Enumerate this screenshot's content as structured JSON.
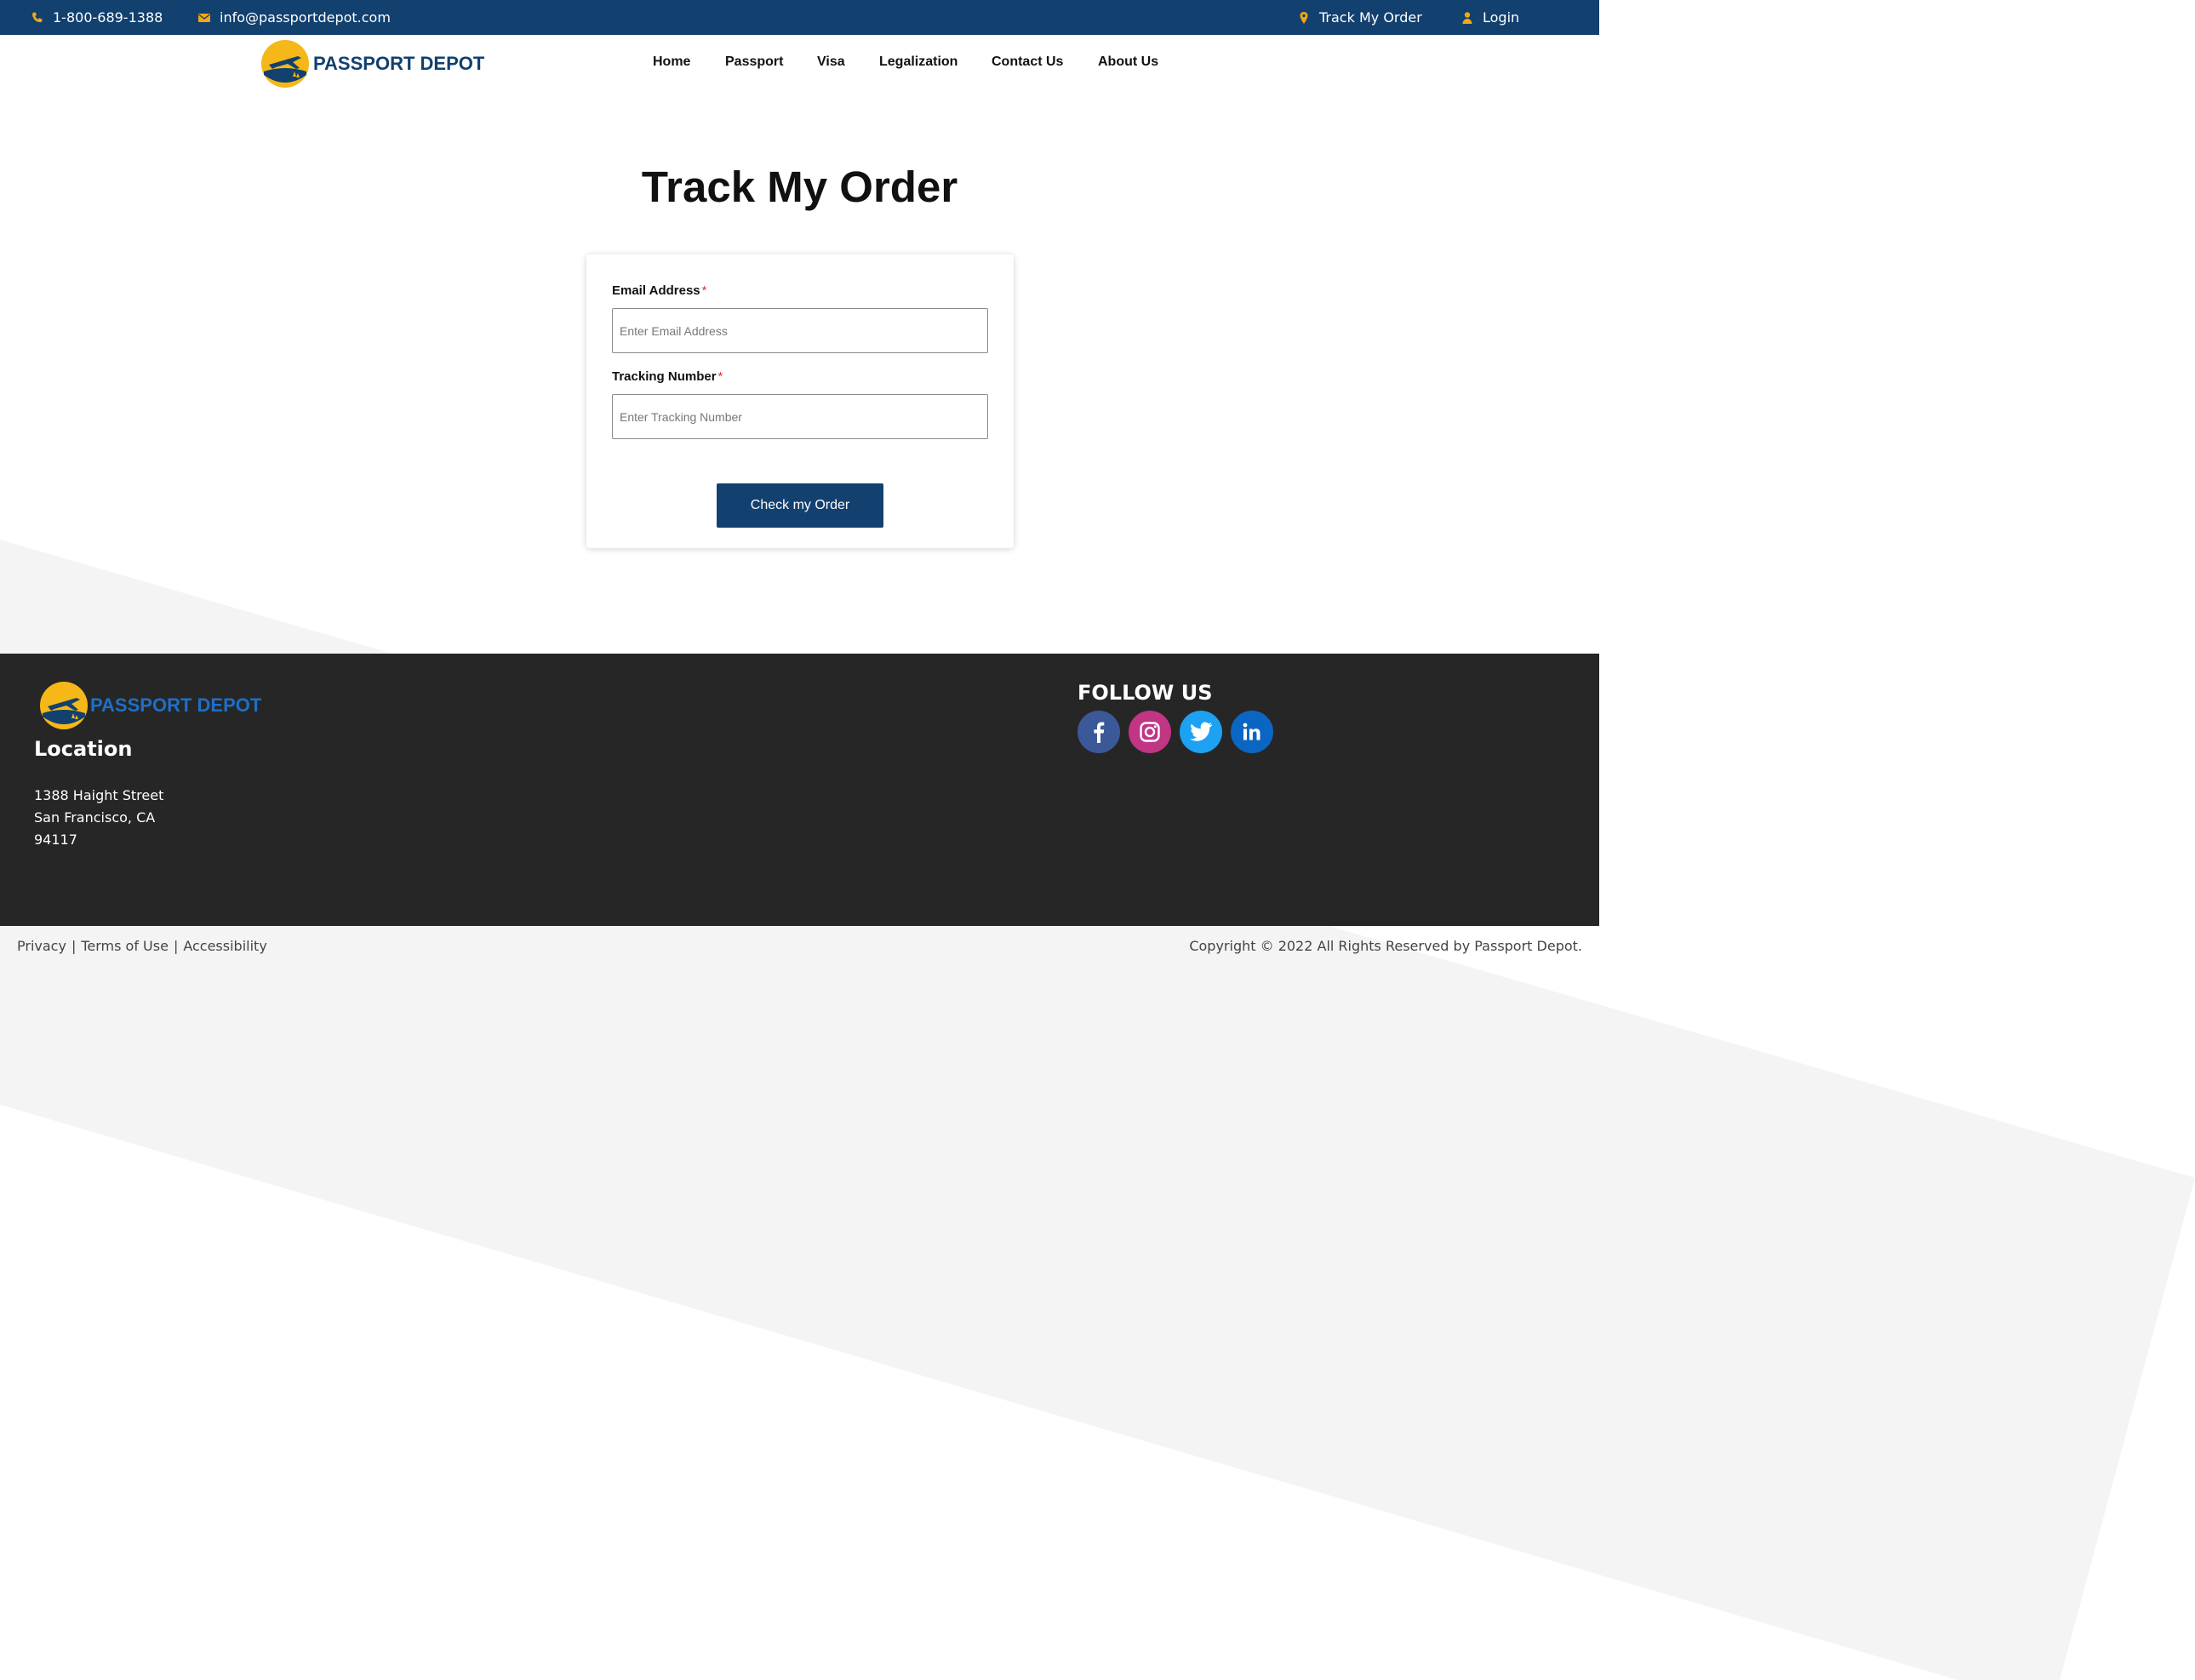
{
  "topbar": {
    "phone": "1-800-689-1388",
    "email": "info@passportdepot.com",
    "track_order": "Track My Order",
    "login": "Login",
    "icons": {
      "phone": "phone-icon",
      "email": "envelope-icon",
      "track": "map-pin-icon",
      "login": "user-icon"
    },
    "icon_color": "#f3a712",
    "background": "#12406f"
  },
  "header": {
    "logo_text": "PASSPORT DEPOT",
    "nav": [
      "Home",
      "Passport",
      "Visa",
      "Legalization",
      "Contact Us",
      "About Us"
    ]
  },
  "main": {
    "title": "Track My Order",
    "form": {
      "email_label": "Email Address",
      "email_placeholder": "Enter Email Address",
      "email_value": "",
      "tracking_label": "Tracking Number",
      "tracking_placeholder": "Enter Tracking Number",
      "tracking_value": "",
      "required_mark": "*",
      "submit_label": "Check my Order"
    }
  },
  "footer": {
    "logo_text": "PASSPORT DEPOT",
    "location_heading": "Location",
    "address": [
      "1388 Haight Street",
      "San Francisco, CA",
      "94117"
    ],
    "follow_heading": "FOLLOW US",
    "socials": [
      {
        "name": "facebook-icon",
        "color": "#3b5998"
      },
      {
        "name": "instagram-icon",
        "color": "#c13584"
      },
      {
        "name": "twitter-icon",
        "color": "#1da1f2"
      },
      {
        "name": "linkedin-icon",
        "color": "#0a66c2"
      }
    ],
    "background": "#262626"
  },
  "bottom": {
    "links": [
      "Privacy",
      "Terms of Use",
      "Accessibility"
    ],
    "separator": "|",
    "copyright": "Copyright © 2022 All Rights Reserved by Passport Depot."
  }
}
